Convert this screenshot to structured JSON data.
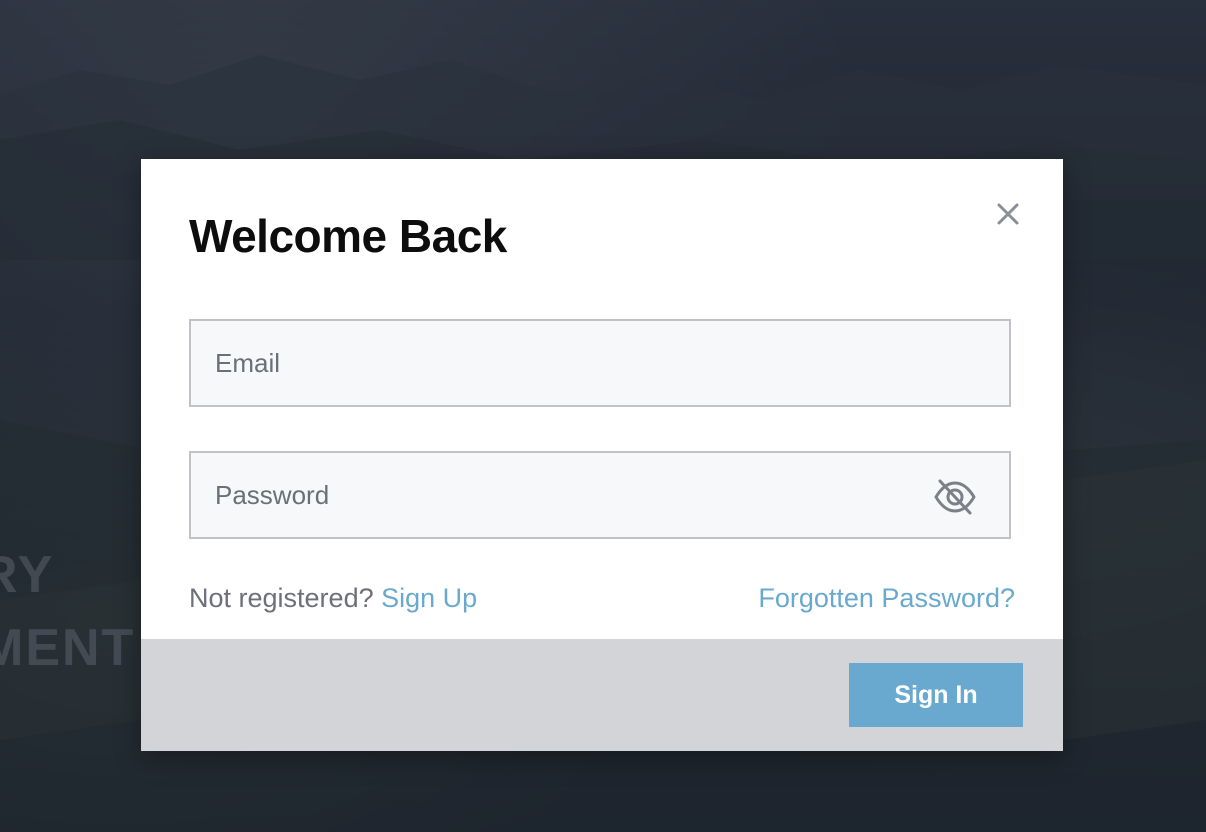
{
  "background": {
    "text_line_1": "RY",
    "text_line_2": "MENT"
  },
  "modal": {
    "title": "Welcome Back",
    "close_icon": "close-icon",
    "email_field": {
      "placeholder": "Email",
      "value": ""
    },
    "password_field": {
      "placeholder": "Password",
      "value": "",
      "toggle_icon": "eye-off-icon"
    },
    "not_registered_text": "Not registered?",
    "signup_label": "Sign Up",
    "forgot_label": "Forgotten Password?",
    "signin_label": "Sign In"
  },
  "colors": {
    "accent": "#6aa9cf",
    "footer_bg": "#d2d4d8",
    "title": "#0d0d0d",
    "muted_text": "#6e7079"
  }
}
